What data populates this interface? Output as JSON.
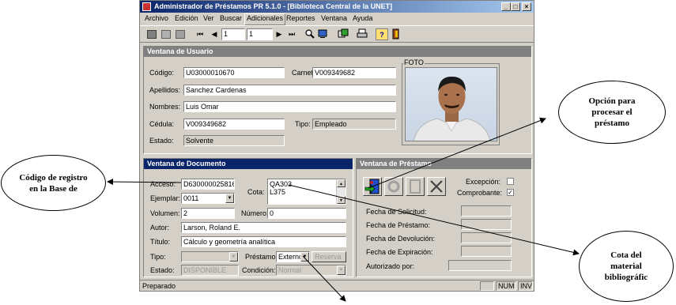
{
  "window": {
    "title": "Administrador de Préstamos PR 5.1.0 - [Biblioteca Central de la UNET]",
    "controls": {
      "minimize": "_",
      "maximize": "□",
      "close": "×"
    }
  },
  "menu": [
    "Archivo",
    "Edición",
    "Ver",
    "Buscar",
    "Adicionales",
    "Reportes",
    "Ventana",
    "Ayuda"
  ],
  "toolbar": {
    "record_current": "1",
    "record_total": "1",
    "first": "⏮",
    "prev": "◀",
    "next": "▶",
    "last": "⏭",
    "help": "?"
  },
  "user_panel": {
    "title": "Ventana de Usuario",
    "codigo_label": "Código:",
    "codigo": "U03000010670",
    "carnet_label": "Carnet:",
    "carnet": "V009349682",
    "apellidos_label": "Apellidos:",
    "apellidos": "Sanchez Cardenas",
    "nombres_label": "Nombres:",
    "nombres": "Luis Omar",
    "cedula_label": "Cédula:",
    "cedula": "V009349682",
    "tipo_label": "Tipo:",
    "tipo": "Empleado",
    "estado_label": "Estado:",
    "estado": "Solvente",
    "foto_label": "FOTO"
  },
  "doc_panel": {
    "title": "Ventana de Documento",
    "acceso_label": "Acceso:",
    "acceso": "D630000025816",
    "cota_label": "Cota:",
    "cota_line1": "QA303",
    "cota_line2": "L375",
    "ejemplar_label": "Ejemplar:",
    "ejemplar": "0011",
    "volumen_label": "Volumen:",
    "volumen": "2",
    "numero_label": "Número:",
    "numero": "0",
    "autor_label": "Autor:",
    "autor": "Larson, Roland E.",
    "titulo_label": "Título:",
    "titulo": "Cálculo y geometría analítica",
    "tipo_label": "Tipo:",
    "tipo": "",
    "prestamo_label": "Préstamo:",
    "prestamo": "Externo",
    "reserva_label": "Reserva",
    "estado_label": "Estado:",
    "estado": "DISPONIBLE",
    "condicion_label": "Condición:",
    "condicion": "Normal"
  },
  "loan_panel": {
    "title": "Ventana de Préstamo",
    "excepcion_label": "Excepción:",
    "excepcion_checked": false,
    "comprobante_label": "Comprobante:",
    "comprobante_checked": true,
    "fecha_solicitud_label": "Fecha de Solicitud:",
    "fecha_prestamo_label": "Fecha de Préstamo:",
    "fecha_devolucion_label": "Fecha de Devolución:",
    "fecha_expiracion_label": "Fecha de Expiración:",
    "autorizado_label": "Autorizado por:"
  },
  "statusbar": {
    "text": "Preparado",
    "num": "NUM",
    "ins": "INV"
  },
  "annotations": {
    "codigo_registro": "Código de registro en la Base de",
    "procesar_prestamo": "Opción para procesar el préstamo",
    "cota_material": "Cota del material bibliográfic"
  },
  "colors": {
    "title_start": "#0a246a",
    "title_end": "#a6caf0",
    "panel_active": "#0a246a",
    "panel_inactive": "#808080",
    "face": "#d4d0c8"
  }
}
